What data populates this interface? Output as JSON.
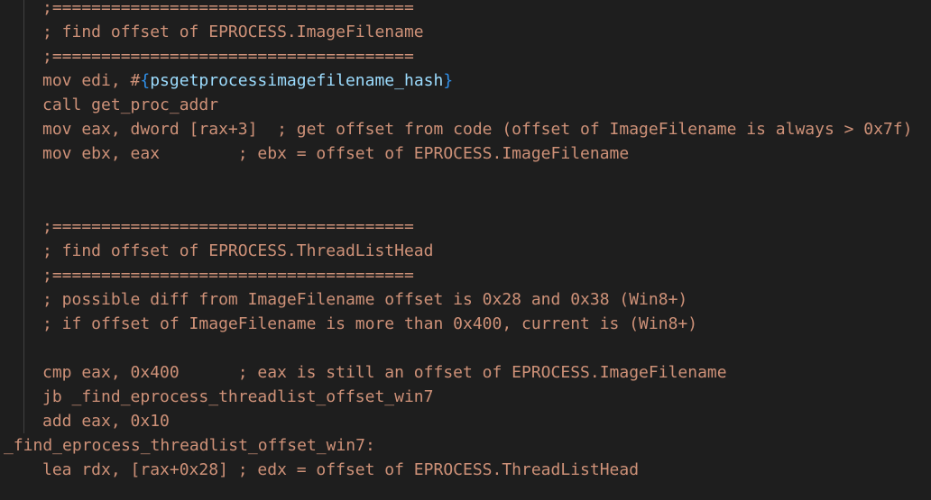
{
  "editor": {
    "lines": [
      ";=====================================",
      "; find offset of EPROCESS.ImageFilename",
      ";=====================================",
      "mov edi, #",
      "{",
      "psgetprocessimagefilename_hash",
      "}",
      "call get_proc_addr",
      "mov eax, dword [rax+3]  ; get offset from code (offset of ImageFilename is always > 0x7f)",
      "mov ebx, eax        ; ebx = offset of EPROCESS.ImageFilename",
      "",
      "",
      ";=====================================",
      "; find offset of EPROCESS.ThreadListHead",
      ";=====================================",
      "; possible diff from ImageFilename offset is 0x28 and 0x38 (Win8+)",
      "; if offset of ImageFilename is more than 0x400, current is (Win8+)",
      "",
      "cmp eax, 0x400      ; eax is still an offset of EPROCESS.ImageFilename",
      "jb _find_eprocess_threadlist_offset_win7",
      "add eax, 0x10",
      "_find_eprocess_threadlist_offset_win7:",
      "lea rdx, [rax+0x28] ; edx = offset of EPROCESS.ThreadListHead"
    ]
  }
}
